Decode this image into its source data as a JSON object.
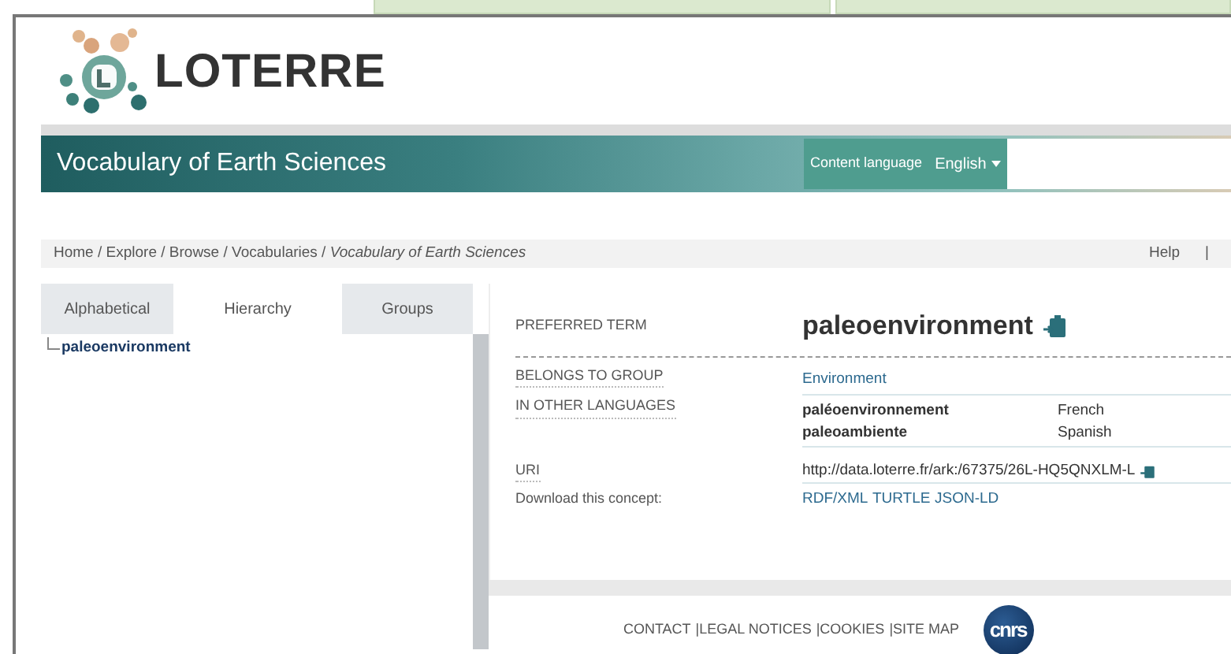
{
  "logo": {
    "text": "LOTERRE"
  },
  "banner": {
    "title": "Vocabulary of Earth Sciences",
    "content_language_label": "Content language",
    "language": "English"
  },
  "breadcrumb": {
    "separator": "/",
    "items": [
      "Home",
      "Explore",
      "Browse",
      "Vocabularies"
    ],
    "current": "Vocabulary of Earth Sciences"
  },
  "help": {
    "label": "Help",
    "separator": "|"
  },
  "tabs": [
    {
      "label": "Alphabetical",
      "selected": false
    },
    {
      "label": "Hierarchy",
      "selected": true
    },
    {
      "label": "Groups",
      "selected": false
    }
  ],
  "tree": [
    {
      "label": "paleoenvironment"
    }
  ],
  "concept": {
    "preferred_term_label": "PREFERRED TERM",
    "preferred_term": "paleoenvironment",
    "group_label": "BELONGS TO GROUP",
    "group": "Environment",
    "languages_label": "IN OTHER LANGUAGES",
    "languages": [
      {
        "term": "paléoenvironnement",
        "language": "French"
      },
      {
        "term": "paleoambiente",
        "language": "Spanish"
      }
    ],
    "uri_label": "URI",
    "uri": "http://data.loterre.fr/ark:/67375/26L-HQ5QNXLM-L",
    "download_label": "Download this concept:",
    "formats": [
      "RDF/XML",
      "TURTLE",
      "JSON-LD"
    ]
  },
  "footer": {
    "separator": "|",
    "links": [
      "CONTACT",
      "LEGAL NOTICES",
      "COOKIES",
      "SITE MAP"
    ],
    "partner_logo": "cnrs"
  }
}
